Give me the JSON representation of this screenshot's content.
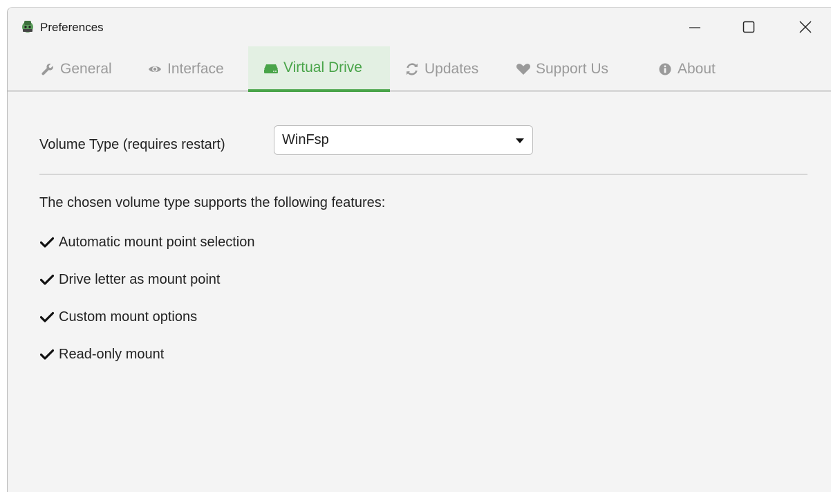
{
  "window": {
    "title": "Preferences",
    "accent": "#49a449"
  },
  "tabs": [
    {
      "label": "General",
      "icon": "wrench-icon",
      "active": false
    },
    {
      "label": "Interface",
      "icon": "eye-icon",
      "active": false
    },
    {
      "label": "Virtual Drive",
      "icon": "hdd-icon",
      "active": true
    },
    {
      "label": "Updates",
      "icon": "refresh-icon",
      "active": false
    },
    {
      "label": "Support Us",
      "icon": "heart-icon",
      "active": false
    },
    {
      "label": "About",
      "icon": "info-icon",
      "active": false
    }
  ],
  "virtual_drive": {
    "volume_type_label": "Volume Type (requires restart)",
    "volume_type_value": "WinFsp",
    "features_intro": "The chosen volume type supports the following features:",
    "features": [
      "Automatic mount point selection",
      "Drive letter as mount point",
      "Custom mount options",
      "Read-only mount"
    ]
  }
}
